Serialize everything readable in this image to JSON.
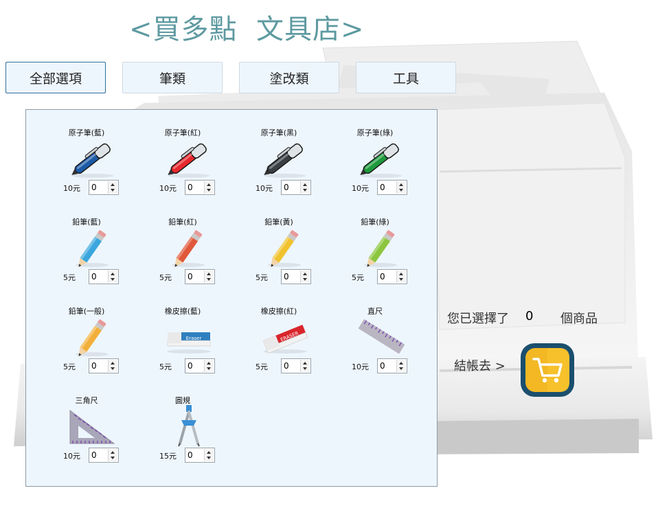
{
  "title": "<買多點  文具店>",
  "tabs": [
    {
      "label": "全部選項",
      "active": true
    },
    {
      "label": "筆類",
      "active": false
    },
    {
      "label": "塗改類",
      "active": false
    },
    {
      "label": "工具",
      "active": false
    }
  ],
  "products": [
    {
      "name": "原子筆(藍)",
      "price": "10元",
      "qty": "0",
      "icon": "pen-icon",
      "color": "#1d5aa6"
    },
    {
      "name": "原子筆(紅)",
      "price": "10元",
      "qty": "0",
      "icon": "pen-icon",
      "color": "#e8262b"
    },
    {
      "name": "原子筆(黑)",
      "price": "10元",
      "qty": "0",
      "icon": "pen-icon",
      "color": "#3a3f44"
    },
    {
      "name": "原子筆(綠)",
      "price": "10元",
      "qty": "0",
      "icon": "pen-icon",
      "color": "#1e9a3c"
    },
    {
      "name": "鉛筆(藍)",
      "price": "5元",
      "qty": "0",
      "icon": "pencil-icon",
      "color": "#3aa6dd"
    },
    {
      "name": "鉛筆(紅)",
      "price": "5元",
      "qty": "0",
      "icon": "pencil-icon",
      "color": "#e0583a"
    },
    {
      "name": "鉛筆(黃)",
      "price": "5元",
      "qty": "0",
      "icon": "pencil-icon",
      "color": "#f0c22e"
    },
    {
      "name": "鉛筆(綠)",
      "price": "5元",
      "qty": "0",
      "icon": "pencil-icon",
      "color": "#8cc63f"
    },
    {
      "name": "鉛筆(一般)",
      "price": "5元",
      "qty": "0",
      "icon": "pencil-icon",
      "color": "#f2b03a"
    },
    {
      "name": "橡皮擦(藍)",
      "price": "5元",
      "qty": "0",
      "icon": "eraser-icon",
      "color": "#2f7fbf",
      "eraser_text": "Eraser"
    },
    {
      "name": "橡皮擦(紅)",
      "price": "5元",
      "qty": "0",
      "icon": "eraser-icon",
      "color": "#d9252c",
      "eraser_text": "ERASER"
    },
    {
      "name": "直尺",
      "price": "10元",
      "qty": "0",
      "icon": "ruler-icon",
      "color": "#b9b6c2"
    },
    {
      "name": "三角尺",
      "price": "10元",
      "qty": "0",
      "icon": "triangle-ruler-icon",
      "color": "#a8a6b8"
    },
    {
      "name": "圓規",
      "price": "15元",
      "qty": "0",
      "icon": "compass-icon",
      "color": "#3a8fd6"
    }
  ],
  "summary": {
    "prefix": "您已選擇了",
    "count": "0",
    "suffix": "個商品",
    "checkout_label": "結帳去 >"
  },
  "colors": {
    "title": "#5e9aa1",
    "panel_bg": "#eef6fd",
    "cart_outer": "#1b4f6e",
    "cart_inner": "#f3b824"
  }
}
